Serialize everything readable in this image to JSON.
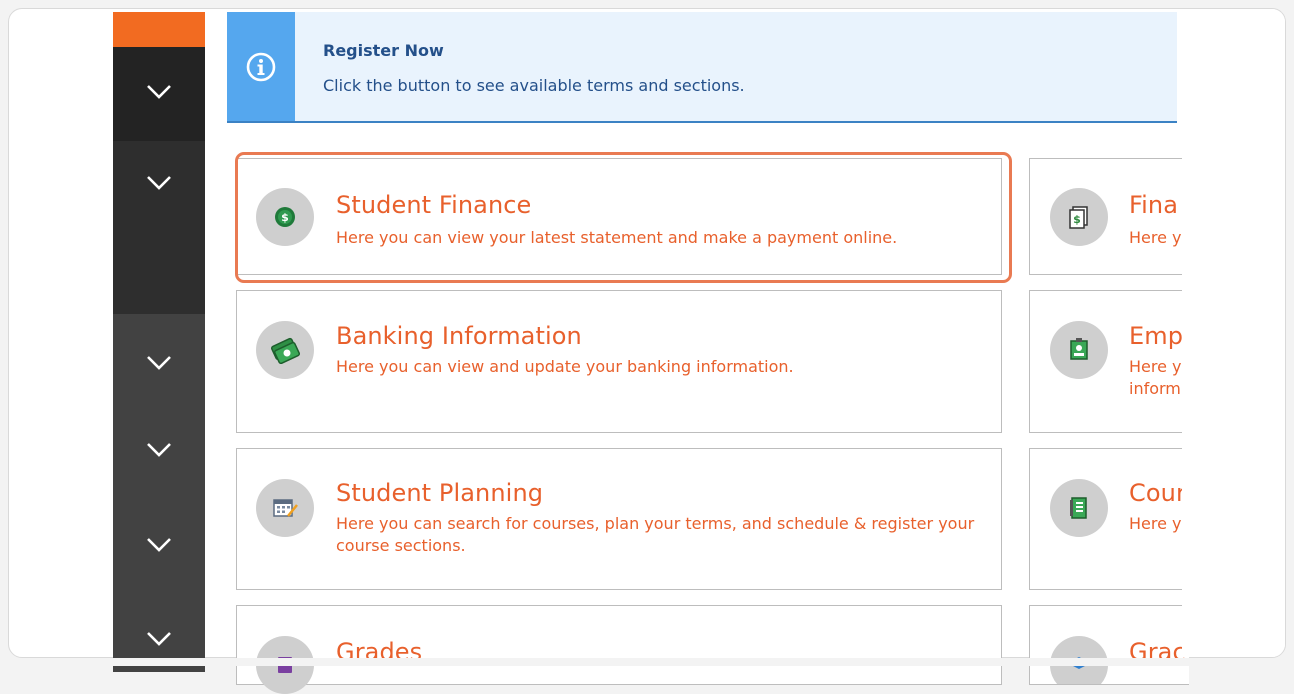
{
  "colors": {
    "accent": "#f26b21",
    "sidebar_dark": "#2a2a2a",
    "sidebar_mid": "#333333",
    "sidebar_light": "#444444",
    "banner_bg": "#e9f3fd",
    "banner_left": "#55a7ee",
    "banner_text": "#24508a",
    "tile_text": "#e8602c",
    "highlight": "#e97a52"
  },
  "sidebar": {
    "items": [
      {
        "icon": "chevron-down-icon"
      },
      {
        "icon": "chevron-down-icon"
      },
      {
        "icon": "chevron-down-icon"
      },
      {
        "icon": "chevron-down-icon"
      },
      {
        "icon": "chevron-down-icon"
      },
      {
        "icon": "chevron-down-icon"
      }
    ]
  },
  "banner": {
    "icon": "info-icon",
    "title": "Register Now",
    "text": "Click the button to see available terms and sections."
  },
  "tiles": {
    "left": [
      {
        "icon": "dollar-coin-icon",
        "title": "Student Finance",
        "desc": "Here you can view your latest statement and make a payment online."
      },
      {
        "icon": "money-stack-icon",
        "title": "Banking Information",
        "desc": "Here you can view and update your banking information."
      },
      {
        "icon": "calendar-icon",
        "title": "Student Planning",
        "desc": "Here you can search for courses, plan your terms, and schedule & register your course sections."
      },
      {
        "icon": "grades-icon",
        "title": "Grades",
        "desc": ""
      }
    ],
    "right": [
      {
        "icon": "financial-document-icon",
        "title": "Fina",
        "desc": "Here y"
      },
      {
        "icon": "employee-badge-icon",
        "title": "Emp",
        "desc": "Here y inform"
      },
      {
        "icon": "notebook-icon",
        "title": "Cour",
        "desc": "Here y"
      },
      {
        "icon": "graduation-cap-icon",
        "title": "Grac",
        "desc": ""
      }
    ]
  }
}
